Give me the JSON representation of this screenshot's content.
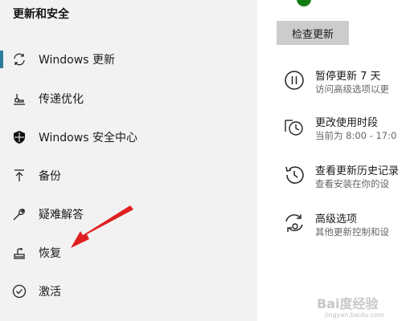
{
  "sidebar": {
    "header": "更新和安全",
    "items": [
      {
        "label": "Windows 更新",
        "icon": "refresh-icon",
        "active": true
      },
      {
        "label": "传递优化",
        "icon": "delivery-optimization-icon"
      },
      {
        "label": "Windows 安全中心",
        "icon": "shield-icon"
      },
      {
        "label": "备份",
        "icon": "backup-arrow-icon"
      },
      {
        "label": "疑难解答",
        "icon": "wrench-icon"
      },
      {
        "label": "恢复",
        "icon": "recovery-icon"
      },
      {
        "label": "激活",
        "icon": "check-circle-icon"
      }
    ]
  },
  "main": {
    "check_button": "检查更新",
    "options": [
      {
        "title": "暂停更新 7 天",
        "subtitle": "访问高级选项以更",
        "icon": "pause-circle-icon"
      },
      {
        "title": "更改使用时段",
        "subtitle": "当前为 8:00 - 17:0",
        "icon": "clock-schedule-icon"
      },
      {
        "title": "查看更新历史记录",
        "subtitle": "查看安装在你的设",
        "icon": "history-icon"
      },
      {
        "title": "高级选项",
        "subtitle": "其他更新控制和设",
        "icon": "advanced-refresh-icon"
      }
    ]
  },
  "colors": {
    "sidebar_bg": "#f2f2f2",
    "accent": "#2d7d9a",
    "status_green": "#107c10",
    "arrow_red": "#e01f1f",
    "button_bg": "#cccccc"
  },
  "watermark": {
    "brand": "Bai度经验",
    "url": "jingyan.baidu.com"
  }
}
